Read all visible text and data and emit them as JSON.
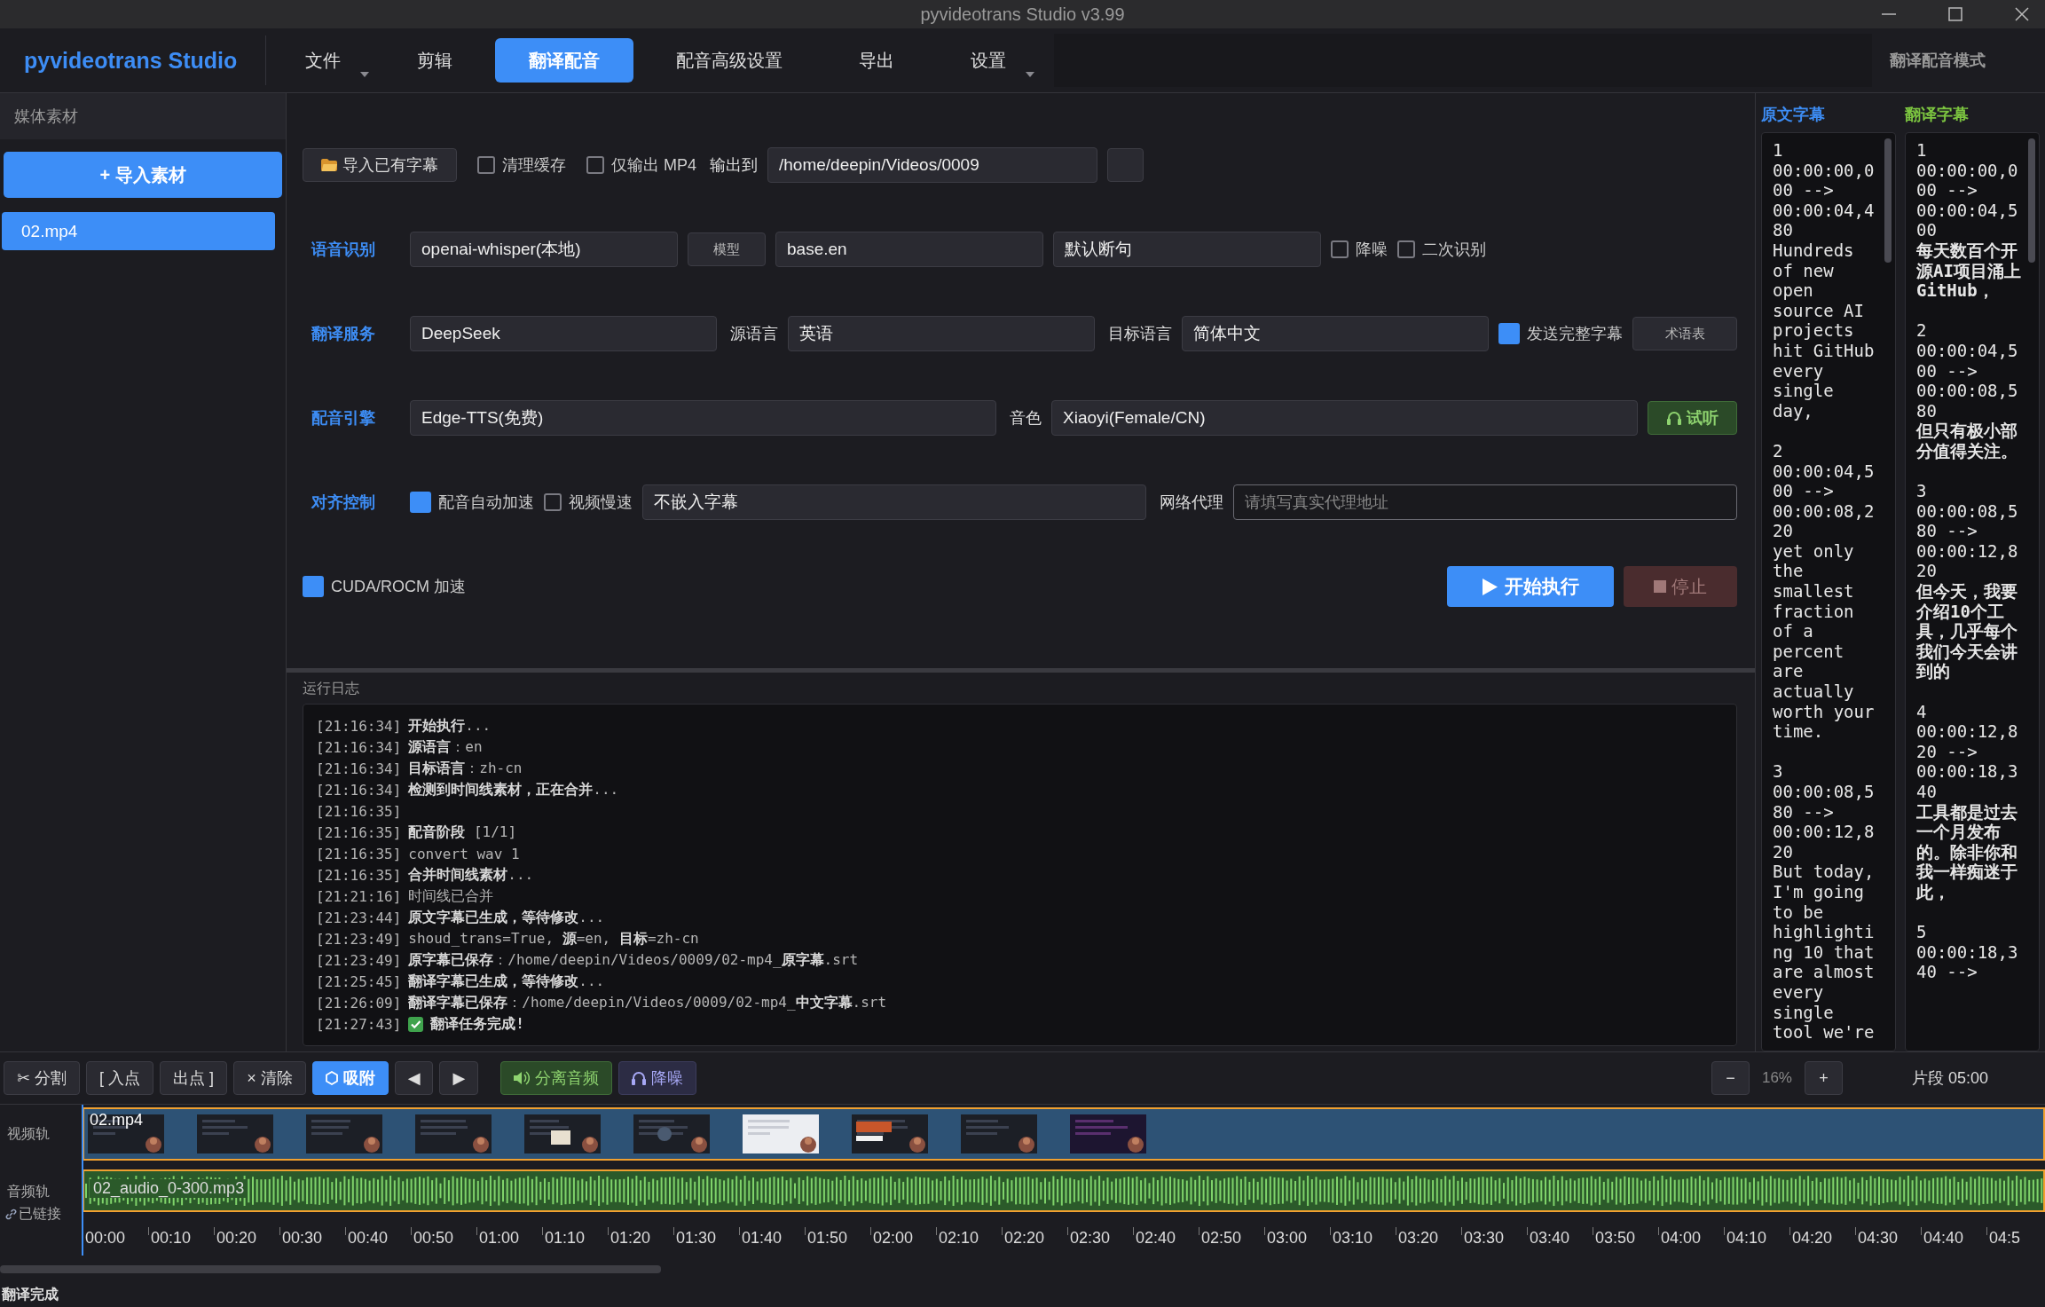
{
  "window": {
    "title": "pyvideotrans Studio v3.99"
  },
  "menubar": {
    "brand": "pyvideotrans Studio",
    "tabs": [
      {
        "label": "文件",
        "dropdown": true,
        "selected": false
      },
      {
        "label": "剪辑",
        "dropdown": false,
        "selected": false
      },
      {
        "label": "翻译配音",
        "dropdown": false,
        "selected": true
      },
      {
        "label": "配音高级设置",
        "dropdown": false,
        "selected": false
      },
      {
        "label": "导出",
        "dropdown": false,
        "selected": false
      },
      {
        "label": "设置",
        "dropdown": true,
        "selected": false
      }
    ],
    "mode": "翻译配音模式"
  },
  "sidebar": {
    "title": "媒体素材",
    "import_button": "+ 导入素材",
    "items": [
      {
        "label": "02.mp4",
        "selected": true
      }
    ]
  },
  "form": {
    "rows": [
      {
        "items": [
          {
            "kind": "button",
            "label": "导入已有字幕"
          },
          {
            "kind": "checkbox",
            "label": "清理缓存",
            "checked": false
          },
          {
            "kind": "checkbox",
            "label": "仅输出 MP4",
            "checked": false
          },
          {
            "kind": "label",
            "label": "输出到"
          },
          {
            "kind": "field",
            "value": "/home/deepin/Videos/0009"
          },
          {
            "kind": "blank_button"
          }
        ]
      },
      {
        "section": "语音识别",
        "items": [
          {
            "kind": "field",
            "value": "openai-whisper(本地)"
          },
          {
            "kind": "small_button",
            "label": "模型"
          },
          {
            "kind": "field",
            "value": "base.en"
          },
          {
            "kind": "field",
            "value": "默认断句"
          },
          {
            "kind": "checkbox",
            "label": "降噪",
            "checked": false
          },
          {
            "kind": "checkbox",
            "label": "二次识别",
            "checked": false
          }
        ]
      },
      {
        "section": "翻译服务",
        "items": [
          {
            "kind": "field",
            "value": "DeepSeek"
          },
          {
            "kind": "label",
            "label": "源语言"
          },
          {
            "kind": "field",
            "value": "英语"
          },
          {
            "kind": "label",
            "label": "目标语言"
          },
          {
            "kind": "field",
            "value": "简体中文"
          },
          {
            "kind": "checkbox",
            "label": "发送完整字幕",
            "checked": true
          },
          {
            "kind": "small_button",
            "label": "术语表"
          }
        ]
      },
      {
        "section": "配音引擎",
        "items": [
          {
            "kind": "field",
            "value": "Edge-TTS(免费)"
          },
          {
            "kind": "label",
            "label": "音色"
          },
          {
            "kind": "field",
            "value": "Xiaoyi(Female/CN)"
          },
          {
            "kind": "listen_button",
            "label": "试听"
          }
        ]
      },
      {
        "section": "对齐控制",
        "items": [
          {
            "kind": "checkbox",
            "label": "配音自动加速",
            "checked": true
          },
          {
            "kind": "checkbox",
            "label": "视频慢速",
            "checked": false
          },
          {
            "kind": "field",
            "value": "不嵌入字幕"
          },
          {
            "kind": "label",
            "label": "网络代理"
          },
          {
            "kind": "input",
            "placeholder": "请填写真实代理地址"
          }
        ]
      },
      {
        "items": [
          {
            "kind": "checkbox",
            "label": "CUDA/ROCM 加速",
            "checked": true
          },
          {
            "kind": "primary",
            "label": "开始执行",
            "disabled": false
          },
          {
            "kind": "danger",
            "label": "停止",
            "disabled": true
          }
        ]
      }
    ]
  },
  "log": {
    "title": "运行日志",
    "lines": [
      {
        "time": "[21:16:34]",
        "text": "**开始执行**..."
      },
      {
        "time": "[21:16:34]",
        "text": "**源语言**：en"
      },
      {
        "time": "[21:16:34]",
        "text": "**目标语言**：zh-cn"
      },
      {
        "time": "[21:16:34]",
        "text": "**检测到时间线素材，正在合并**..."
      },
      {
        "time": "[21:16:35]"
      },
      {
        "time": "[21:16:35]",
        "text": "**配音阶段** [1/1]"
      },
      {
        "time": "[21:16:35]",
        "text": "convert wav 1"
      },
      {
        "time": "[21:16:35]",
        "text": "**合并时间线素材**..."
      },
      {
        "time": "[21:21:16]",
        "text": "时间线已合并"
      },
      {
        "time": "[21:23:44]",
        "text": "**原文字幕已生成，等待修改**..."
      },
      {
        "time": "[21:23:49]",
        "text": "shoud_trans=True, **源**=en, **目标**=zh-cn"
      },
      {
        "time": "[21:23:49]",
        "text": "**原字幕已保存**：/home/deepin/Videos/0009/02-mp4_**原字幕**.srt"
      },
      {
        "time": "[21:25:45]",
        "text": "**翻译字幕已生成，等待修改**..."
      },
      {
        "time": "[21:26:09]",
        "text": "**翻译字幕已保存**：/home/deepin/Videos/0009/02-mp4_**中文字幕**.srt"
      },
      {
        "time": "[21:27:43]",
        "kind": "success",
        "text": "翻译任务完成!"
      }
    ]
  },
  "subtitles": [
    {
      "title": "原文字幕",
      "color": "#3d8df5",
      "kind": "source",
      "entries": [
        {
          "index": "1",
          "timing": "00:00:00,000 --> 00:00:04,480",
          "text": "Hundreds of new open source AI projects hit GitHub every single day,"
        },
        {
          "index": "2",
          "timing": "00:00:04,500 --> 00:00:08,220",
          "text": "yet only the smallest fraction of a percent are actually worth your time."
        },
        {
          "index": "3",
          "timing": "00:00:08,580 --> 00:00:12,820",
          "text": "But today, I'm going to be highlighting 10 that are almost every single tool we're"
        }
      ]
    },
    {
      "title": "翻译字幕",
      "color": "#7cc540",
      "kind": "translation",
      "entries": [
        {
          "index": "1",
          "timing": "00:00:00,000 --> 00:00:04,500",
          "text": "每天数百个开源AI项目涌上GitHub，"
        },
        {
          "index": "2",
          "timing": "00:00:04,500 --> 00:00:08,580",
          "text": "但只有极小部分值得关注。"
        },
        {
          "index": "3",
          "timing": "00:00:08,580 --> 00:00:12,820",
          "text": "但今天，我要介绍10个工具，几乎每个我们今天会讲到的"
        },
        {
          "index": "4",
          "timing": "00:00:12,820 --> 00:00:18,340",
          "text": "工具都是过去一个月发布的。除非你和我一样痴迷于此，"
        },
        {
          "index": "5",
          "timing": "00:00:18,340 -->"
        }
      ]
    }
  ],
  "timeline": {
    "tools": [
      {
        "label": "✂ 分割",
        "kind": "plain",
        "selected": false
      },
      {
        "label": "[ 入点",
        "kind": "plain",
        "selected": false
      },
      {
        "label": "出点 ]",
        "kind": "plain",
        "selected": false
      },
      {
        "label": "× 清除",
        "kind": "plain",
        "selected": false
      },
      {
        "label": "吸附",
        "kind": "snap",
        "selected": true
      },
      {
        "label": "◀",
        "kind": "plain",
        "selected": false
      },
      {
        "label": "▶",
        "kind": "plain",
        "selected": false
      },
      {
        "label": "分离音频",
        "kind": "audio",
        "selected": false
      },
      {
        "label": "降噪",
        "kind": "denoise",
        "selected": false
      }
    ],
    "zoom_out": "−",
    "zoom_level": "16%",
    "zoom_in": "+",
    "segment": "片段 05:00",
    "tracks": [
      {
        "kind": "video",
        "label": "视频轨",
        "clip": "02.mp4"
      },
      {
        "kind": "audio",
        "label": "音频轨",
        "link": "已链接",
        "clip": "02_audio_0-300.mp3"
      }
    ],
    "ruler": [
      "00:00",
      "00:10",
      "00:20",
      "00:30",
      "00:40",
      "00:50",
      "01:00",
      "01:10",
      "01:20",
      "01:30",
      "01:40",
      "01:50",
      "02:00",
      "02:10",
      "02:20",
      "02:30",
      "02:40",
      "02:50",
      "03:00",
      "03:10",
      "03:20",
      "03:30",
      "03:40",
      "03:50",
      "04:00",
      "04:10",
      "04:20",
      "04:30",
      "04:40",
      "04:5"
    ]
  },
  "status_bar": {
    "text": "翻译完成"
  }
}
